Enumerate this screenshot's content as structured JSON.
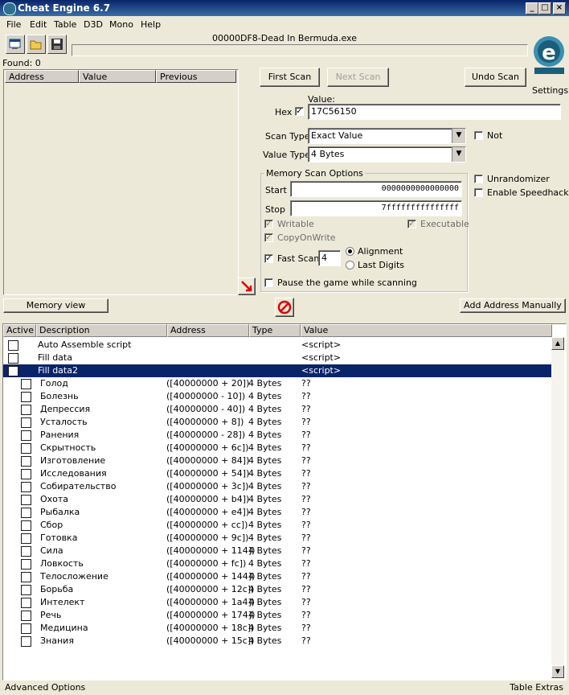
{
  "window": {
    "title": "Cheat Engine 6.7"
  },
  "menu": [
    "File",
    "Edit",
    "Table",
    "D3D",
    "Mono",
    "Help"
  ],
  "process_title": "00000DF8-Dead In Bermuda.exe",
  "found_label": "Found: 0",
  "results_columns": [
    "Address",
    "Value",
    "Previous"
  ],
  "buttons": {
    "first_scan": "First Scan",
    "next_scan": "Next Scan",
    "undo_scan": "Undo Scan",
    "memory_view": "Memory view",
    "add_address": "Add Address Manually"
  },
  "settings_label": "Settings",
  "value_label": "Value:",
  "hex_label": "Hex",
  "value_input": "17C56150",
  "scan_type": {
    "label": "Scan Type",
    "value": "Exact Value"
  },
  "value_type": {
    "label": "Value Type",
    "value": "4 Bytes"
  },
  "not_label": "Not",
  "memory_options": {
    "title": "Memory Scan Options",
    "start_label": "Start",
    "start_value": "0000000000000000",
    "stop_label": "Stop",
    "stop_value": "7fffffffffffffff",
    "writable": "Writable",
    "executable": "Executable",
    "copyonwrite": "CopyOnWrite",
    "fast_scan": "Fast Scan",
    "fast_scan_value": "4",
    "alignment": "Alignment",
    "last_digits": "Last Digits"
  },
  "pause_label": "Pause the game while scanning",
  "unrandomizer": "Unrandomizer",
  "speedhack": "Enable Speedhack",
  "table_columns": [
    "Active",
    "Description",
    "Address",
    "Type",
    "Value"
  ],
  "table_rows": [
    {
      "desc": "Auto Assemble script",
      "address": "",
      "type": "",
      "value": "<script>",
      "indent": 0,
      "selected": false
    },
    {
      "desc": "Fill data",
      "address": "",
      "type": "",
      "value": "<script>",
      "indent": 0,
      "selected": false
    },
    {
      "desc": "Fill data2",
      "address": "",
      "type": "",
      "value": "<script>",
      "indent": 0,
      "selected": true
    },
    {
      "desc": "Голод",
      "address": "([40000000 + 20])",
      "type": "4 Bytes",
      "value": "??",
      "indent": 1,
      "selected": false
    },
    {
      "desc": "Болезнь",
      "address": "([40000000 - 10])",
      "type": "4 Bytes",
      "value": "??",
      "indent": 1,
      "selected": false
    },
    {
      "desc": "Депрессия",
      "address": "([40000000 - 40])",
      "type": "4 Bytes",
      "value": "??",
      "indent": 1,
      "selected": false
    },
    {
      "desc": "Усталость",
      "address": "([40000000 + 8])",
      "type": "4 Bytes",
      "value": "??",
      "indent": 1,
      "selected": false
    },
    {
      "desc": "Ранения",
      "address": "([40000000 - 28])",
      "type": "4 Bytes",
      "value": "??",
      "indent": 1,
      "selected": false
    },
    {
      "desc": "Скрытность",
      "address": "([40000000 + 6c])",
      "type": "4 Bytes",
      "value": "??",
      "indent": 1,
      "selected": false
    },
    {
      "desc": "Изготовление",
      "address": "([40000000 + 84])",
      "type": "4 Bytes",
      "value": "??",
      "indent": 1,
      "selected": false
    },
    {
      "desc": "Исследования",
      "address": "([40000000 + 54])",
      "type": "4 Bytes",
      "value": "??",
      "indent": 1,
      "selected": false
    },
    {
      "desc": "Собирательство",
      "address": "([40000000 + 3c])",
      "type": "4 Bytes",
      "value": "??",
      "indent": 1,
      "selected": false
    },
    {
      "desc": "Охота",
      "address": "([40000000 + b4])",
      "type": "4 Bytes",
      "value": "??",
      "indent": 1,
      "selected": false
    },
    {
      "desc": "Рыбалка",
      "address": "([40000000 + e4])",
      "type": "4 Bytes",
      "value": "??",
      "indent": 1,
      "selected": false
    },
    {
      "desc": "Сбор",
      "address": "([40000000 + cc])",
      "type": "4 Bytes",
      "value": "??",
      "indent": 1,
      "selected": false
    },
    {
      "desc": "Готовка",
      "address": "([40000000 + 9c])",
      "type": "4 Bytes",
      "value": "??",
      "indent": 1,
      "selected": false
    },
    {
      "desc": "Сила",
      "address": "([40000000 + 114])",
      "type": "4 Bytes",
      "value": "??",
      "indent": 1,
      "selected": false
    },
    {
      "desc": "Ловкость",
      "address": "([40000000 + fc])",
      "type": "4 Bytes",
      "value": "??",
      "indent": 1,
      "selected": false
    },
    {
      "desc": "Телосложение",
      "address": "([40000000 + 144])",
      "type": "4 Bytes",
      "value": "??",
      "indent": 1,
      "selected": false
    },
    {
      "desc": "Борьба",
      "address": "([40000000 + 12c])",
      "type": "4 Bytes",
      "value": "??",
      "indent": 1,
      "selected": false
    },
    {
      "desc": "Интелект",
      "address": "([40000000 + 1a4])",
      "type": "4 Bytes",
      "value": "??",
      "indent": 1,
      "selected": false
    },
    {
      "desc": "Речь",
      "address": "([40000000 + 174])",
      "type": "4 Bytes",
      "value": "??",
      "indent": 1,
      "selected": false
    },
    {
      "desc": "Медицина",
      "address": "([40000000 + 18c])",
      "type": "4 Bytes",
      "value": "??",
      "indent": 1,
      "selected": false
    },
    {
      "desc": "Знания",
      "address": "([40000000 + 15c])",
      "type": "4 Bytes",
      "value": "??",
      "indent": 1,
      "selected": false
    }
  ],
  "footer": {
    "left": "Advanced Options",
    "right": "Table Extras"
  },
  "logo_text": "Cheat Engine",
  "colors": {
    "selection": "#0a246a",
    "titlebar": "#0a246a",
    "face": "#ece9d8"
  }
}
